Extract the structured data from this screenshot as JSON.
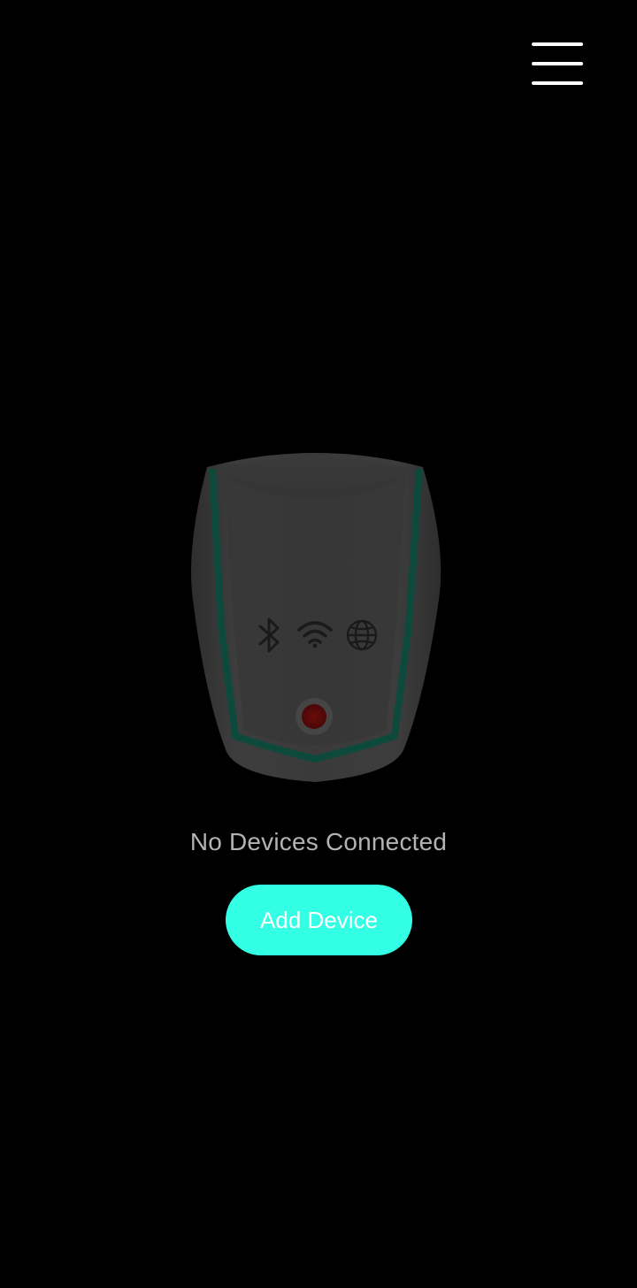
{
  "header": {
    "menu_icon": "hamburger-menu-icon"
  },
  "device": {
    "illustration_icon": "hub-device-icon",
    "status_icons": [
      "bluetooth-icon",
      "wifi-icon",
      "globe-icon"
    ],
    "indicator_color": "#5a0a0a",
    "accent_stripe_color": "#0e4a3c"
  },
  "main": {
    "status_text": "No Devices Connected",
    "add_button_label": "Add Device",
    "accent_color": "#33ffe5"
  }
}
